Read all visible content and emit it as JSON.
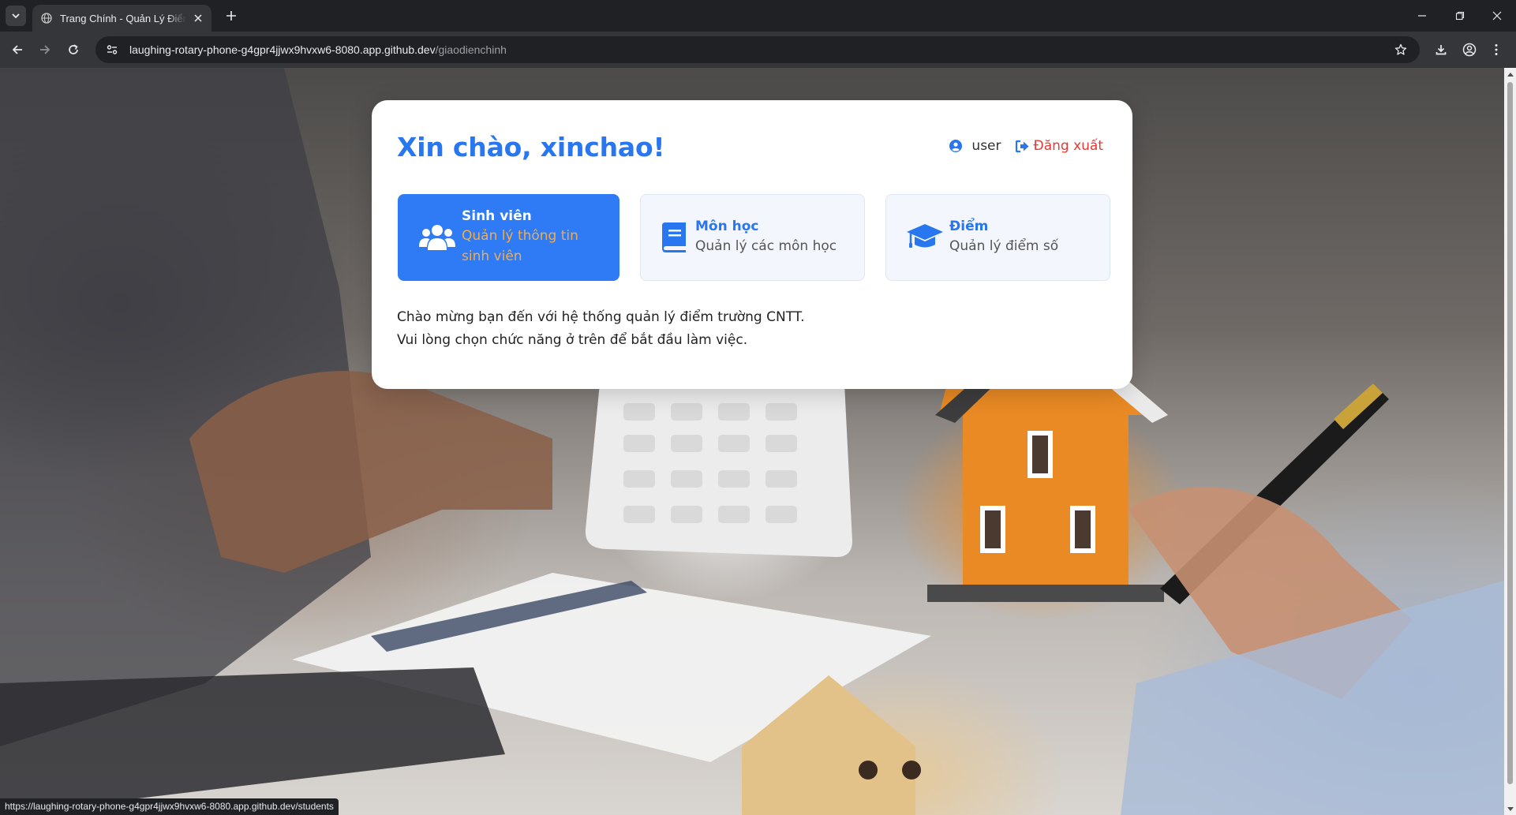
{
  "browser": {
    "tab_title": "Trang Chính - Quản Lý Điểm Trường CNTT",
    "url_host": "laughing-rotary-phone-g4gpr4jjwx9hvxw6-8080.app.github.dev",
    "url_path": "/giaodienchinh",
    "status_url": "https://laughing-rotary-phone-g4gpr4jjwx9hvxw6-8080.app.github.dev/students"
  },
  "header": {
    "greeting": "Xin chào, xinchao!",
    "user_name": "user",
    "logout_label": "Đăng xuất"
  },
  "tiles": [
    {
      "title": "Sinh viên",
      "desc": "Quản lý thông tin sinh viên",
      "icon": "users-icon"
    },
    {
      "title": "Môn học",
      "desc": "Quản lý các môn học",
      "icon": "book-icon"
    },
    {
      "title": "Điểm",
      "desc": "Quản lý điểm số",
      "icon": "graduation-cap-icon"
    }
  ],
  "welcome": {
    "line1": "Chào mừng bạn đến với hệ thống quản lý điểm trường CNTT.",
    "line2": "Vui lòng chọn chức năng ở trên để bắt đầu làm việc."
  },
  "colors": {
    "primary": "#2876f0",
    "tile_active": "#2f7bf5",
    "logout": "#e53935",
    "tile_active_desc": "#f0ad4e"
  }
}
